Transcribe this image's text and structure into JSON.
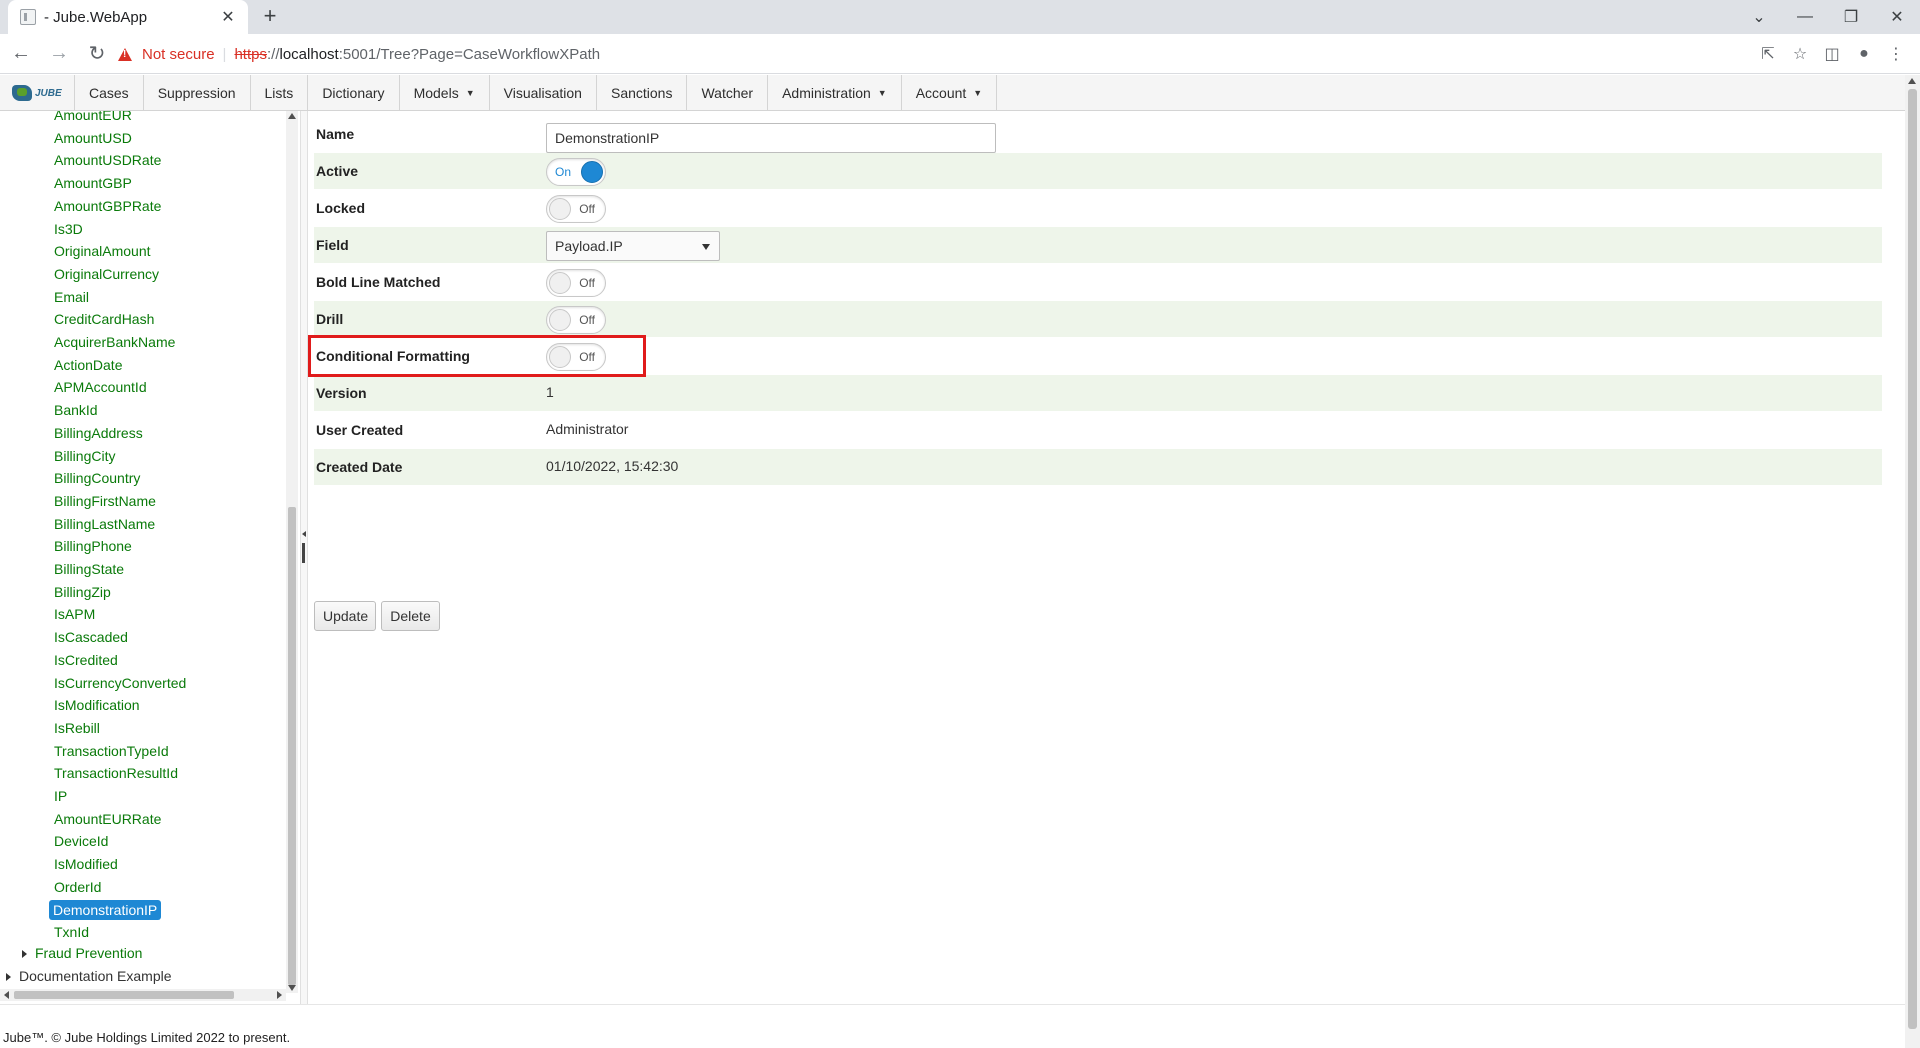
{
  "browser": {
    "tab_title": "- Jube.WebApp",
    "new_tab": "+",
    "tab_close": "✕",
    "not_secure": "Not secure",
    "url_scheme": "https",
    "url_sep": "://",
    "url_host": "localhost",
    "url_rest": ":5001/Tree?Page=CaseWorkflowXPath",
    "window_controls": [
      "⌄",
      "—",
      "❐",
      "✕"
    ]
  },
  "menu": {
    "logo_text": "JUBE",
    "items": [
      {
        "label": "Cases",
        "dropdown": false
      },
      {
        "label": "Suppression",
        "dropdown": false
      },
      {
        "label": "Lists",
        "dropdown": false
      },
      {
        "label": "Dictionary",
        "dropdown": false
      },
      {
        "label": "Models",
        "dropdown": true
      },
      {
        "label": "Visualisation",
        "dropdown": false
      },
      {
        "label": "Sanctions",
        "dropdown": false
      },
      {
        "label": "Watcher",
        "dropdown": false
      },
      {
        "label": "Administration",
        "dropdown": true
      },
      {
        "label": "Account",
        "dropdown": true
      }
    ]
  },
  "tree": {
    "items": [
      "AmountEUR",
      "AmountUSD",
      "AmountUSDRate",
      "AmountGBP",
      "AmountGBPRate",
      "Is3D",
      "OriginalAmount",
      "OriginalCurrency",
      "Email",
      "CreditCardHash",
      "AcquirerBankName",
      "ActionDate",
      "APMAccountId",
      "BankId",
      "BillingAddress",
      "BillingCity",
      "BillingCountry",
      "BillingFirstName",
      "BillingLastName",
      "BillingPhone",
      "BillingState",
      "BillingZip",
      "IsAPM",
      "IsCascaded",
      "IsCredited",
      "IsCurrencyConverted",
      "IsModification",
      "IsRebill",
      "TransactionTypeId",
      "TransactionResultId",
      "IP",
      "AmountEURRate",
      "DeviceId",
      "IsModified",
      "OrderId",
      "DemonstrationIP",
      "TxnId"
    ],
    "selected": "DemonstrationIP",
    "fraud_node": "Fraud Prevention",
    "doc_node": "Documentation Example"
  },
  "form": {
    "name_label": "Name",
    "name_value": "DemonstrationIP",
    "active_label": "Active",
    "active_state": "On",
    "locked_label": "Locked",
    "locked_state": "Off",
    "field_label": "Field",
    "field_value": "Payload.IP",
    "bold_label": "Bold Line Matched",
    "bold_state": "Off",
    "drill_label": "Drill",
    "drill_state": "Off",
    "cond_label": "Conditional Formatting",
    "cond_state": "Off",
    "version_label": "Version",
    "version_value": "1",
    "user_label": "User Created",
    "user_value": "Administrator",
    "date_label": "Created Date",
    "date_value": "01/10/2022, 15:42:30",
    "update_button": "Update",
    "delete_button": "Delete"
  },
  "footer": {
    "text": "Jube™. © Jube Holdings Limited 2022 to present."
  },
  "colors": {
    "tree_link": "#0a7a0a",
    "selected_bg": "#1e88d4",
    "row_alt": "#eef5ea",
    "highlight": "#e01b1b"
  }
}
